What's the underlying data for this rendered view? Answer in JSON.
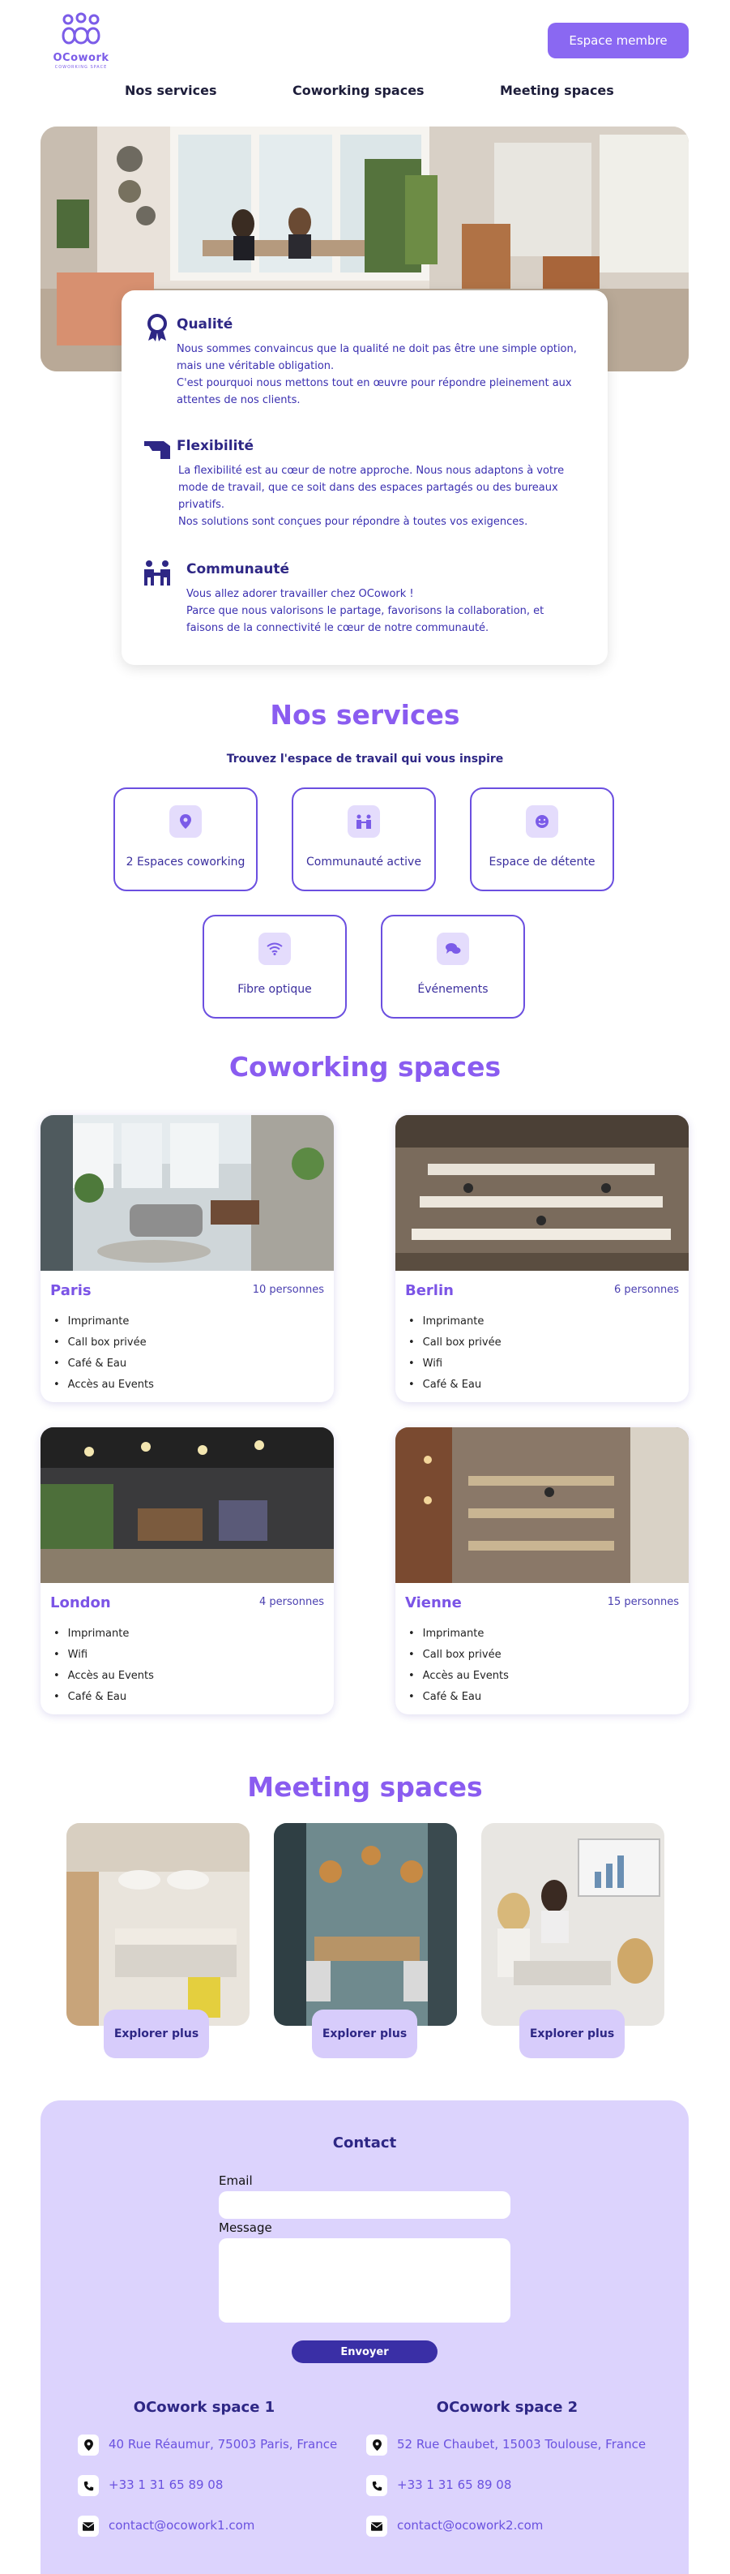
{
  "header": {
    "brand": "OCowork",
    "brand_tagline": "COWORKING SPACE",
    "member_button": "Espace membre",
    "nav": [
      "Nos services",
      "Coworking spaces",
      "Meeting spaces"
    ]
  },
  "values": [
    {
      "title": "Qualité",
      "icon": "award-ribbon-icon",
      "text": "Nous sommes convaincus que la qualité ne doit pas être une simple option, mais une véritable obligation.\nC'est pourquoi nous mettons tout en œuvre pour répondre pleinement aux attentes de nos clients."
    },
    {
      "title": "Flexibilité",
      "icon": "flexible-hand-icon",
      "text": "La flexibilité est au cœur de notre approche. Nous nous adaptons à votre mode de travail, que ce soit dans des espaces partagés ou des bureaux privatifs.\nNos solutions sont conçues pour répondre à toutes vos exigences."
    },
    {
      "title": "Communauté",
      "icon": "community-people-icon",
      "text": "Vous allez adorer travailler chez OCowork !\nParce que nous valorisons le partage, favorisons la collaboration, et faisons de la connectivité le cœur de notre communauté."
    }
  ],
  "services": {
    "title": "Nos services",
    "subtitle": "Trouvez l'espace de travail qui vous inspire",
    "items": [
      {
        "label": "2 Espaces coworking",
        "icon": "location-pin-icon"
      },
      {
        "label": "Communauté active",
        "icon": "people-icon"
      },
      {
        "label": "Espace de détente",
        "icon": "smile-icon"
      },
      {
        "label": "Fibre optique",
        "icon": "wifi-icon"
      },
      {
        "label": "Événements",
        "icon": "chat-bubbles-icon"
      }
    ]
  },
  "coworking": {
    "title": "Coworking spaces",
    "spaces": [
      {
        "city": "Paris",
        "capacity": "10 personnes",
        "features": [
          "Imprimante",
          "Call box privée",
          "Café & Eau",
          "Accès au Events"
        ]
      },
      {
        "city": "Berlin",
        "capacity": "6 personnes",
        "features": [
          "Imprimante",
          "Call box privée",
          "Wifi",
          "Café & Eau"
        ]
      },
      {
        "city": "London",
        "capacity": "4 personnes",
        "features": [
          "Imprimante",
          "Wifi",
          "Accès au Events",
          "Café & Eau"
        ]
      },
      {
        "city": "Vienne",
        "capacity": "15 personnes",
        "features": [
          "Imprimante",
          "Call box privée",
          "Accès au Events",
          "Café & Eau"
        ]
      }
    ]
  },
  "meeting": {
    "title": "Meeting spaces",
    "button": "Explorer plus"
  },
  "contact": {
    "title": "Contact",
    "email_label": "Email",
    "message_label": "Message",
    "send": "Envoyer",
    "offices": [
      {
        "name": "OCowork space 1",
        "address": "40 Rue Réaumur, 75003 Paris, France",
        "phone": "+33 1 31 65 89 08",
        "email": "contact@ocowork1.com"
      },
      {
        "name": "OCowork space 2",
        "address": "52 Rue Chaubet, 15003 Toulouse, France",
        "phone": "+33 1 31 65 89 08",
        "email": "contact@ocowork2.com"
      }
    ]
  },
  "colors": {
    "accent": "#8a68f2",
    "heading": "#8a5cf0",
    "dark": "#2e2785",
    "contact_bg": "#dcd3fd"
  }
}
